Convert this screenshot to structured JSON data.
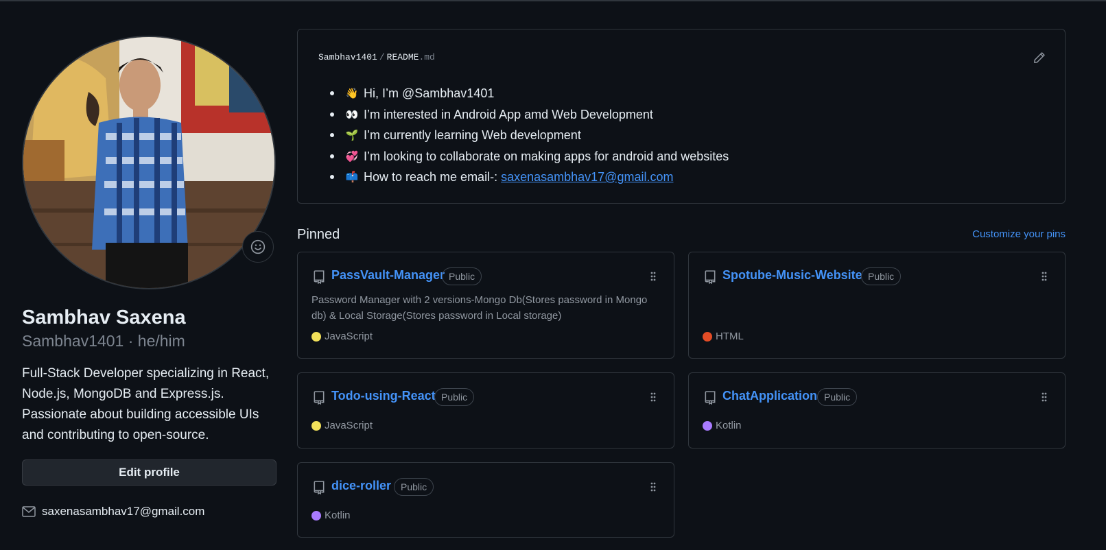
{
  "profile": {
    "full_name": "Sambhav Saxena",
    "login_line": "Sambhav1401 · he/him",
    "bio": "Full-Stack Developer specializing in React, Node.js, MongoDB and Express.js. Passionate about building accessible UIs and contributing to open-source.",
    "edit_label": "Edit profile",
    "email": "saxenasambhav17@gmail.com"
  },
  "readme": {
    "owner": "Sambhav1401",
    "separator": "/",
    "file_name": "README",
    "file_ext": ".md",
    "items": [
      {
        "emoji": "👋",
        "text": "Hi, I’m @Sambhav1401"
      },
      {
        "emoji": "👀",
        "text": "I’m interested in Android App amd Web Development"
      },
      {
        "emoji": "🌱",
        "text": "I’m currently learning Web development"
      },
      {
        "emoji": "💞️",
        "text": "I’m looking to collaborate on making apps for android and websites"
      },
      {
        "emoji": "📫",
        "text": "How to reach me email-:",
        "link": "saxenasambhav17@gmail.com"
      }
    ]
  },
  "pinned": {
    "title": "Pinned",
    "customize_label": "Customize your pins",
    "repos": [
      {
        "name": "PassVault-Manager",
        "visibility": "Public",
        "description": "Password Manager with 2 versions-Mongo Db(Stores password in Mongo db) & Local Storage(Stores password in Local storage)",
        "language": "JavaScript",
        "language_color": "#f1e05a"
      },
      {
        "name": "Spotube-Music-Website",
        "visibility": "Public",
        "description": "",
        "language": "HTML",
        "language_color": "#e34c26"
      },
      {
        "name": "Todo-using-React",
        "visibility": "Public",
        "description": "",
        "language": "JavaScript",
        "language_color": "#f1e05a"
      },
      {
        "name": "ChatApplication",
        "visibility": "Public",
        "description": "",
        "language": "Kotlin",
        "language_color": "#a97bff"
      },
      {
        "name": "dice-roller",
        "visibility": "Public",
        "description": "",
        "language": "Kotlin",
        "language_color": "#a97bff"
      }
    ]
  },
  "colors": {
    "background": "#0d1117",
    "border": "#30363d",
    "link": "#4493f8",
    "muted": "#9198a1"
  },
  "icons": {
    "status": "smiley-icon",
    "edit_readme": "pencil-icon",
    "repo": "repo-icon",
    "drag": "grabber-icon",
    "email": "mail-icon"
  }
}
